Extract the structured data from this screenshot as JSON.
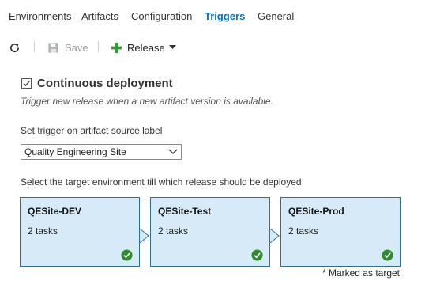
{
  "tabs": [
    {
      "label": "Environments",
      "active": false
    },
    {
      "label": "Artifacts",
      "active": false
    },
    {
      "label": "Configuration",
      "active": false
    },
    {
      "label": "Triggers",
      "active": true
    },
    {
      "label": "General",
      "active": false
    }
  ],
  "toolbar": {
    "refresh_icon": "refresh-icon",
    "save_label": "Save",
    "release_label": "Release"
  },
  "trigger": {
    "title": "Continuous deployment",
    "checked": true,
    "description": "Trigger new release when a new artifact version is available.",
    "source_label": "Set trigger on artifact source label",
    "source_value": "Quality Engineering Site",
    "target_label": "Select the target environment till which release should be deployed"
  },
  "environments": [
    {
      "name": "QESite-DEV",
      "tasks": "2 tasks",
      "status": "succeeded"
    },
    {
      "name": "QESite-Test",
      "tasks": "2 tasks",
      "status": "succeeded"
    },
    {
      "name": "QESite-Prod",
      "tasks": "2 tasks",
      "status": "succeeded"
    }
  ],
  "footnote": "* Marked as target",
  "colors": {
    "accent": "#0b6fbf",
    "card_bg": "#d6eaf8",
    "card_border": "#2c6e9e",
    "success": "#2e8b2e",
    "add_green": "#2f9e2f"
  }
}
